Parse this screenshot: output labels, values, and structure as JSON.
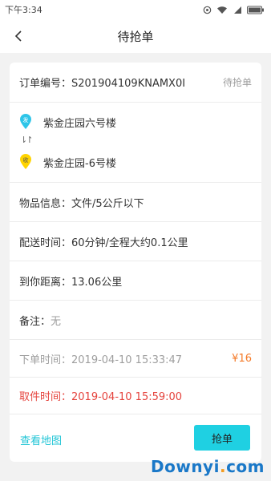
{
  "status": {
    "time": "下午3:34"
  },
  "header": {
    "title": "待抢单"
  },
  "order": {
    "number_label": "订单编号：S201904109KNAMX0I",
    "status_text": "待抢单",
    "from_address": "紫金庄园六号楼",
    "to_address": "紫金庄园-6号楼",
    "from_pin_label": "发",
    "to_pin_label": "收",
    "swap_symbol": "⇂↾",
    "goods_info": "物品信息：文件/5公斤以下",
    "delivery_time": "配送时间：60分钟/全程大约0.1公里",
    "distance": "到你距离：13.06公里",
    "note_label": "备注：",
    "note_value": "无",
    "order_time": "下单时间：2019-04-10 15:33:47",
    "price": "¥16",
    "pickup_time": "取件时间：2019-04-10 15:59:00"
  },
  "actions": {
    "view_map": "查看地图",
    "grab": "抢单"
  },
  "watermark": {
    "text_main": "Downyi",
    "text_dot": ".",
    "text_tail": "com"
  },
  "colors": {
    "accent": "#1fd0e2",
    "price": "#f47b2a",
    "pickup": "#e5433d",
    "from_pin": "#2ec5e8",
    "to_pin": "#ffd400"
  }
}
